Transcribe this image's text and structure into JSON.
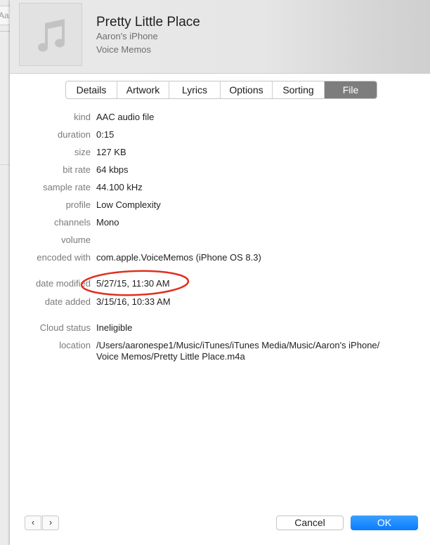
{
  "background": {
    "search_fragment": "Aa"
  },
  "header": {
    "title": "Pretty Little Place",
    "device": "Aaron's iPhone",
    "album": "Voice Memos",
    "artwork_icon": "music-note-icon"
  },
  "tabs": [
    {
      "label": "Details",
      "active": false
    },
    {
      "label": "Artwork",
      "active": false
    },
    {
      "label": "Lyrics",
      "active": false
    },
    {
      "label": "Options",
      "active": false
    },
    {
      "label": "Sorting",
      "active": false
    },
    {
      "label": "File",
      "active": true
    }
  ],
  "file_info": {
    "kind": {
      "label": "kind",
      "value": "AAC audio file"
    },
    "duration": {
      "label": "duration",
      "value": "0:15"
    },
    "size": {
      "label": "size",
      "value": "127 KB"
    },
    "bit_rate": {
      "label": "bit rate",
      "value": "64 kbps"
    },
    "sample_rate": {
      "label": "sample rate",
      "value": "44.100 kHz"
    },
    "profile": {
      "label": "profile",
      "value": "Low Complexity"
    },
    "channels": {
      "label": "channels",
      "value": "Mono"
    },
    "volume": {
      "label": "volume",
      "value": ""
    },
    "encoded_with": {
      "label": "encoded with",
      "value": "com.apple.VoiceMemos (iPhone OS 8.3)"
    },
    "date_modified": {
      "label": "date modified",
      "value": "5/27/15, 11:30 AM"
    },
    "date_added": {
      "label": "date added",
      "value": "3/15/16, 10:33 AM"
    },
    "cloud_status": {
      "label": "Cloud status",
      "value": "Ineligible"
    },
    "location": {
      "label": "location",
      "line1": "/Users/aaronespe1/Music/iTunes/iTunes Media/Music/Aaron's iPhone/",
      "line2": "Voice Memos/Pretty Little Place.m4a"
    }
  },
  "annotation": {
    "color": "#e0301e"
  },
  "footer": {
    "prev_icon": "chevron-left-icon",
    "next_icon": "chevron-right-icon",
    "cancel_label": "Cancel",
    "ok_label": "OK",
    "ok_color": "#0a7cff"
  }
}
